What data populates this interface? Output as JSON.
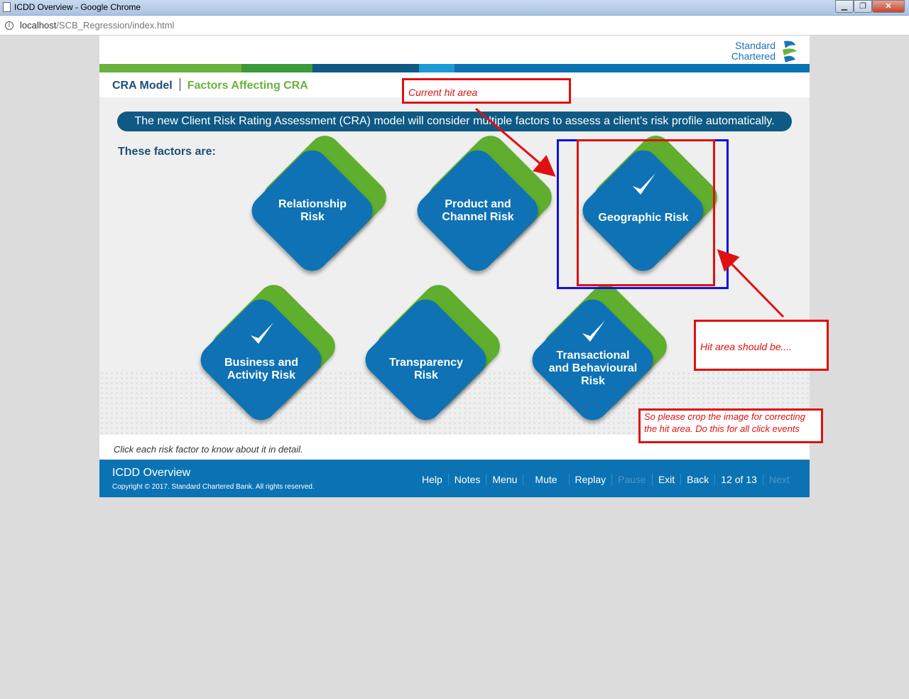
{
  "window": {
    "title": "ICDD Overview - Google Chrome",
    "min_label": "▁",
    "max_label": "❐",
    "close_label": "✕"
  },
  "address": {
    "host": "localhost",
    "path": "/SCB_Regression/index.html"
  },
  "logo": {
    "line1": "Standard",
    "line2": "Chartered"
  },
  "stripe_colors": [
    "#6ab23e",
    "#3b9a3a",
    "#0f5a85",
    "#1a9ad6",
    "#0b73b3"
  ],
  "header": {
    "crumb1": "CRA Model",
    "crumb2": "Factors Affecting CRA"
  },
  "banner": "The new Client Risk Rating Assessment (CRA) model will consider multiple factors to assess a client’s risk profile automatically.",
  "factors_label": "These factors are:",
  "factors": [
    {
      "line1": "Relationship",
      "line2": "Risk",
      "line3": "",
      "checked": false
    },
    {
      "line1": "Product and",
      "line2": "Channel Risk",
      "line3": "",
      "checked": false
    },
    {
      "line1": "Geographic Risk",
      "line2": "",
      "line3": "",
      "checked": true
    },
    {
      "line1": "Business and",
      "line2": "Activity Risk",
      "line3": "",
      "checked": true
    },
    {
      "line1": "Transparency",
      "line2": "Risk",
      "line3": "",
      "checked": false
    },
    {
      "line1": "Transactional",
      "line2": "and Behavioural",
      "line3": "Risk",
      "checked": true
    }
  ],
  "hint": "Click each risk factor to know about it in detail.",
  "footer": {
    "title": "ICDD Overview",
    "copyright": "Copyright © 2017. Standard Chartered Bank. All rights reserved.",
    "help": "Help",
    "notes": "Notes",
    "menu": "Menu",
    "mute": "Mute",
    "replay": "Replay",
    "pause": "Pause",
    "exit": "Exit",
    "back": "Back",
    "page": "12 of 13",
    "next": "Next"
  },
  "annotations": {
    "current": "Current hit area",
    "should": "Hit area should be....",
    "crop": "So please crop the image for correcting the hit area. Do this for all click events"
  },
  "colors": {
    "annotation_red": "#e01010",
    "annotation_blue": "#1010e0",
    "brand_blue": "#0b73b3",
    "brand_green": "#6ab23e"
  }
}
